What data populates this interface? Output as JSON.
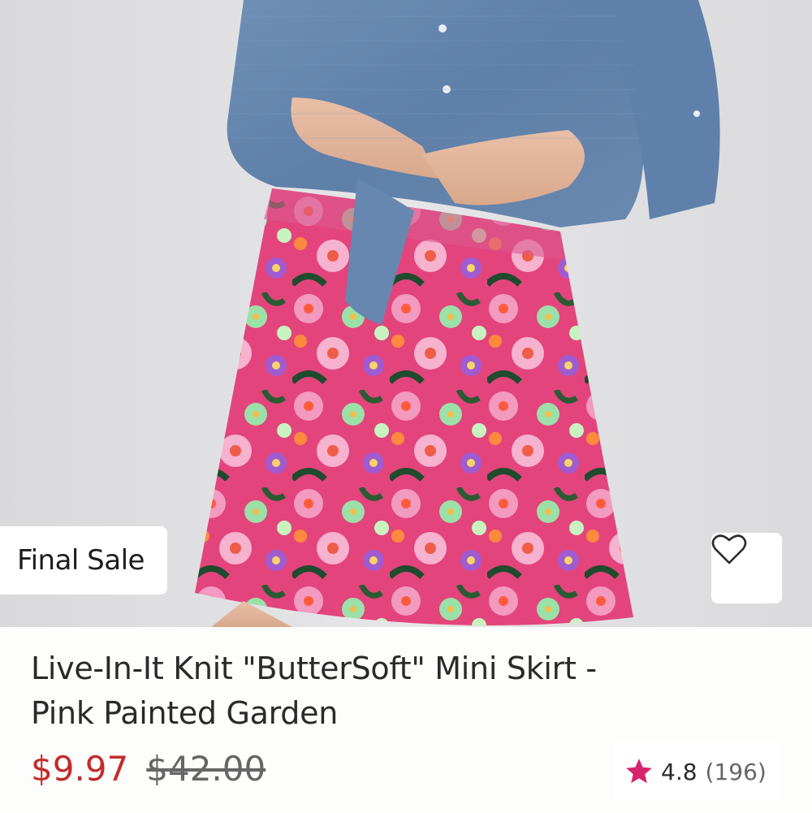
{
  "product": {
    "badge": "Final Sale",
    "title": "Live-In-It Knit \"ButterSoft\" Mini Skirt - Pink Painted Garden",
    "sale_price": "$9.97",
    "original_price": "$42.00",
    "rating": "4.8",
    "review_count": "(196)",
    "image_description_icon": "product-photo"
  },
  "icons": {
    "wishlist": "heart-outline-icon",
    "rating": "star-icon"
  },
  "colors": {
    "sale_price": "#c42a2a",
    "star": "#d8236e",
    "background": "#fdfdfb"
  }
}
